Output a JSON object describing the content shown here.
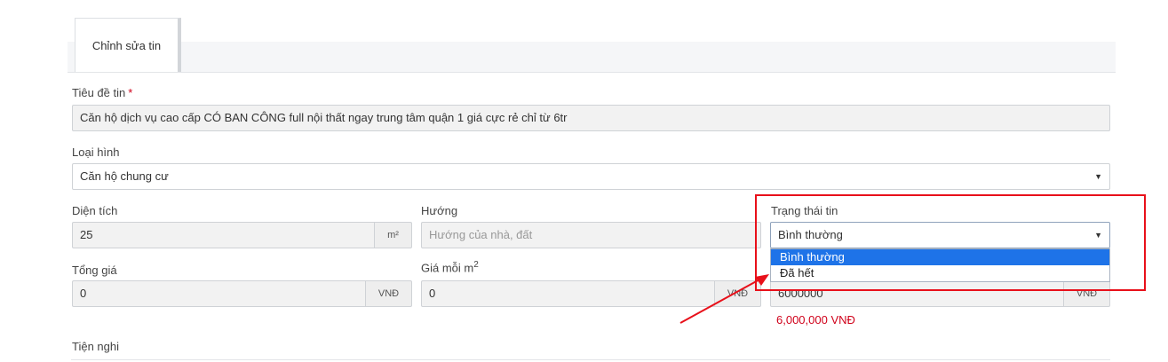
{
  "tab": {
    "label": "Chỉnh sửa tin"
  },
  "title_field": {
    "label": "Tiêu đề tin",
    "required_mark": "*",
    "value": "Căn hộ dịch vụ cao cấp CÓ BAN CÔNG full nội thất ngay trung tâm quận 1 giá cực rẻ chỉ từ 6tr"
  },
  "type_field": {
    "label": "Loại hình",
    "value": "Căn hộ chung cư"
  },
  "area_field": {
    "label": "Diện tích",
    "value": "25",
    "unit": "m²"
  },
  "direction_field": {
    "label": "Hướng",
    "placeholder": "Hướng của nhà, đất"
  },
  "status_field": {
    "label": "Trạng thái tin",
    "value": "Bình thường",
    "options": [
      "Bình thường",
      "Đã hết"
    ]
  },
  "total_price_field": {
    "label": "Tổng giá",
    "value": "0",
    "unit": "VNĐ"
  },
  "unit_price_field": {
    "label": "Giá mỗi m",
    "label_sup": "2",
    "value": "0",
    "unit": "VNĐ"
  },
  "rent_price_field": {
    "value": "6000000",
    "unit": "VNĐ",
    "formatted": "6,000,000 VNĐ"
  },
  "amenities": {
    "label": "Tiện nghi"
  },
  "colors": {
    "highlight": "#e8101a",
    "selection": "#1e73e8",
    "required": "#d0021b"
  }
}
